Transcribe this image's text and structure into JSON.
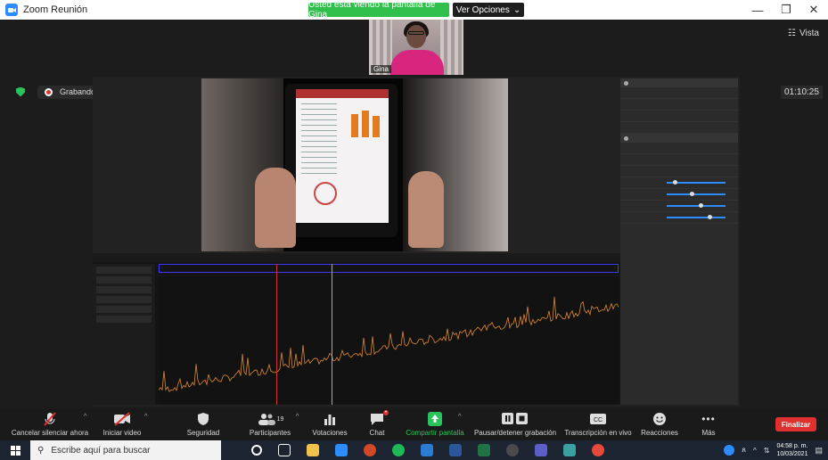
{
  "window": {
    "title": "Zoom Reunión",
    "share_banner": "Usted está viendo la pantalla de Gina",
    "view_options": "Ver Opciones",
    "view_button": "Vista"
  },
  "participant": {
    "name": "Gina"
  },
  "recording": {
    "label": "Grabando...",
    "timer": "01:10:25"
  },
  "toolbar": {
    "unmute": "Cancelar silenciar ahora",
    "video": "Iniciar video",
    "security": "Seguridad",
    "participants": "Participantes",
    "participants_count": "19",
    "polls": "Votaciones",
    "chat": "Chat",
    "share": "Compartir pantalla",
    "record": "Pausar/detener grabación",
    "transcription": "Transcripción en vivo",
    "reactions": "Reacciones",
    "more": "Más",
    "end": "Finalizar"
  },
  "taskbar": {
    "search_placeholder": "Escribe aquí para buscar",
    "time": "04:58 p. m.",
    "date": "10/03/2021"
  },
  "colors": {
    "zoom_blue": "#2d8cff",
    "share_green": "#2fbf4a",
    "end_red": "#e02f2f"
  }
}
